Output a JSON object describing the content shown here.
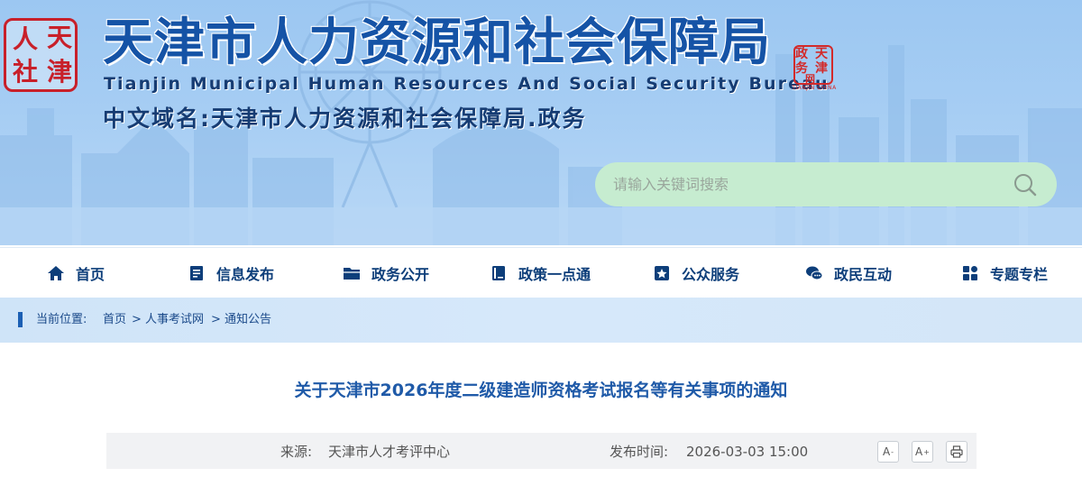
{
  "header": {
    "seal_chars": [
      "人",
      "天",
      "社",
      "津"
    ],
    "title": "天津市人力资源和社会保障局",
    "subtitle": "Tianjin Municipal Human Resources And Social Security Bureau",
    "domain": "中文域名:天津市人力资源和社会保障局.政务",
    "gov_seal": {
      "chars": [
        "政",
        "天",
        "务",
        "津",
        "网"
      ],
      "caption": "TIANJIN CHINA"
    },
    "search": {
      "placeholder": "请输入关键词搜索",
      "icon": "search-icon"
    }
  },
  "nav": {
    "items": [
      {
        "label": "首页",
        "icon": "home-icon"
      },
      {
        "label": "信息发布",
        "icon": "document-icon"
      },
      {
        "label": "政务公开",
        "icon": "folder-icon"
      },
      {
        "label": "政策一点通",
        "icon": "book-icon"
      },
      {
        "label": "公众服务",
        "icon": "service-icon"
      },
      {
        "label": "政民互动",
        "icon": "chat-icon"
      },
      {
        "label": "专题专栏",
        "icon": "grid-icon"
      }
    ]
  },
  "breadcrumb": {
    "prefix": "当前位置:",
    "items": [
      "首页",
      "人事考试网",
      "通知公告"
    ],
    "separator": ">"
  },
  "article": {
    "title": "关于天津市2026年度二级建造师资格考试报名等有关事项的通知",
    "source_label": "来源:",
    "source": "天津市人才考评中心",
    "date_label": "发布时间:",
    "date": "2026-03-03 15:00",
    "tools": {
      "font_smaller": "A",
      "font_larger": "A",
      "font_smaller_sign": "-",
      "font_larger_sign": "+",
      "print_icon": "print-icon"
    }
  },
  "colors": {
    "title_blue": "#1553a6",
    "nav_text": "#0d3e7a",
    "article_title": "#1f5aa8",
    "seal_red": "#c8202a",
    "search_bg": "#c6ecd0"
  }
}
